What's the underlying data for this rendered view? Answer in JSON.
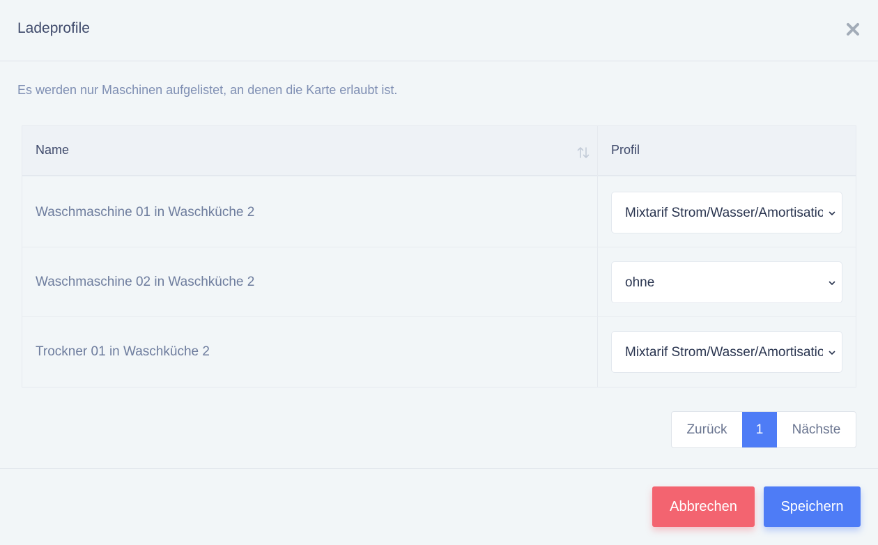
{
  "modal": {
    "title": "Ladeprofile",
    "close_icon": "close-icon"
  },
  "info_text": "Es werden nur Maschinen aufgelistet, an denen die Karte erlaubt ist.",
  "table": {
    "columns": [
      {
        "label": "Name",
        "sortable": true,
        "sort_icon": "sort-updown-icon"
      },
      {
        "label": "Profil"
      }
    ],
    "rows": [
      {
        "name": "Waschmaschine 01 in Waschküche 2",
        "profile": "Mixtarif Strom/Wasser/Amortisation"
      },
      {
        "name": "Waschmaschine 02 in Waschküche 2",
        "profile": "ohne"
      },
      {
        "name": "Trockner 01 in Waschküche 2",
        "profile": "Mixtarif Strom/Wasser/Amortisation"
      }
    ]
  },
  "pagination": {
    "prev_label": "Zurück",
    "current_page": "1",
    "next_label": "Nächste"
  },
  "footer": {
    "cancel_label": "Abbrechen",
    "save_label": "Speichern"
  },
  "colors": {
    "primary": "#4e7cf6",
    "danger": "#f36470",
    "background": "#f2f6f8",
    "title_text": "#3f4a6b",
    "muted_text": "#7f8fb3"
  }
}
